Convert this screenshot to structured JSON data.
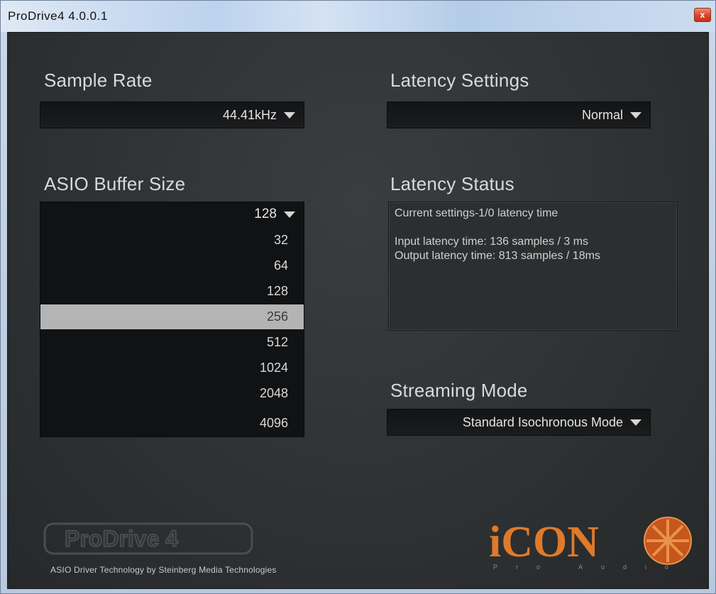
{
  "window": {
    "title": "ProDrive4 4.0.0.1",
    "close_label": "x"
  },
  "sample_rate": {
    "label": "Sample Rate",
    "value": "44.41kHz"
  },
  "latency_settings": {
    "label": "Latency Settings",
    "value": "Normal"
  },
  "asio_buffer": {
    "label": "ASIO Buffer Size",
    "value": "128",
    "options": [
      "32",
      "64",
      "128",
      "256",
      "512",
      "1024",
      "2048",
      "4096"
    ],
    "highlighted": "256"
  },
  "latency_status": {
    "label": "Latency Status",
    "line1": "Current settings-1/0 latency time",
    "line2": "Input latency time: 136 samples / 3 ms",
    "line3": "Output latency time: 813 samples / 18ms"
  },
  "streaming_mode": {
    "label": "Streaming Mode",
    "value": "Standard Isochronous Mode"
  },
  "footer": {
    "prodrive_logo_text": "ProDrive 4",
    "tech_credit": "ASIO Driver Technology by Steinberg Media Technologies",
    "brand_logo_text": "iCON",
    "brand_sub_text": "Pro Audio"
  },
  "colors": {
    "panel_bg": "#2e3133",
    "dropdown_bg": "#141516",
    "text": "#d9d9d9",
    "selected_row": "#b4b4b4",
    "brand_orange": "#e07a2a"
  },
  "icons": [
    "close-icon",
    "dropdown-caret-icon",
    "prodrive-logo",
    "icon-pro-audio-logo"
  ]
}
